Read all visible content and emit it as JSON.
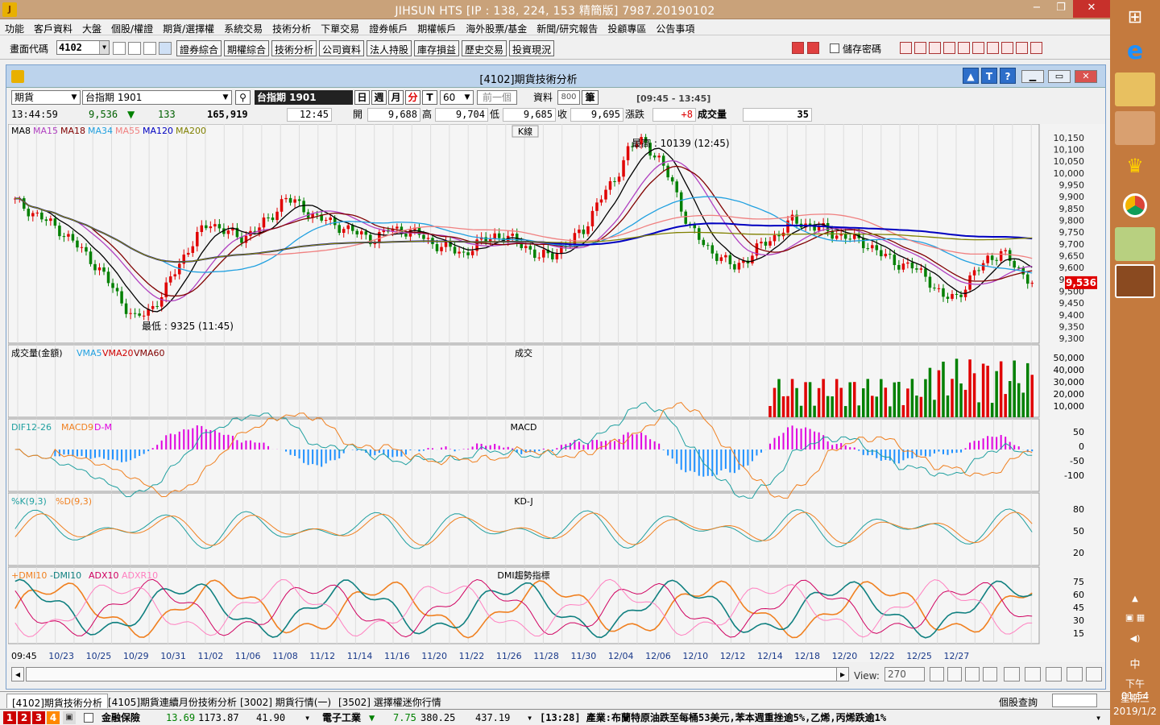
{
  "window": {
    "title": "JIHSUN HTS     [IP : 138, 224, 153 精簡版] 7987.20190102",
    "app_icon": "jihsun-logo",
    "controls": [
      "−",
      "❐",
      "✕"
    ]
  },
  "menu": [
    "功能",
    "客戶資料",
    "大盤",
    "個股/權證",
    "期貨/選擇權",
    "系統交易",
    "技術分析",
    "下單交易",
    "證券帳戶",
    "期權帳戶",
    "海外股票/基金",
    "新聞/研究報告",
    "投顧專區",
    "公告事項"
  ],
  "toolbar": {
    "code_label": "畫面代碼",
    "code_value": "4102",
    "buttons": [
      "證券綜合",
      "期權綜合",
      "技術分析",
      "公司資料",
      "法人持股",
      "庫存損益",
      "歷史交易",
      "投資現況"
    ],
    "save_code_label": "儲存密碼"
  },
  "inner": {
    "title": "[4102]期貨技術分析",
    "help_buttons": [
      "▲",
      "T",
      "?"
    ],
    "controls": [
      "▁",
      "▭",
      "✕"
    ]
  },
  "controls": {
    "type": "期貨",
    "instrument": "台指期 1901",
    "instrument_name": "台指期 1901",
    "periods": [
      "日",
      "週",
      "月",
      "分",
      "T"
    ],
    "interval": "60",
    "prev_button": "前一個",
    "data_label": "資料",
    "data_count": "800",
    "data_unit": "筆",
    "session": "[09:45 - 13:45]"
  },
  "quote": {
    "time": "13:44:59",
    "price": "9,536",
    "arrow": "▼",
    "change": "133",
    "volume": "165,919",
    "bar_time": "12:45",
    "open_label": "開",
    "open": "9,688",
    "high_label": "高",
    "high": "9,704",
    "low_label": "低",
    "low": "9,685",
    "close_label": "收",
    "close": "9,695",
    "chg_label": "漲跌",
    "chg": "+8",
    "vol_label": "成交量",
    "vol": "35"
  },
  "panels": {
    "kline": {
      "title": "K線",
      "legend": [
        {
          "name": "MA8",
          "color": "#000000"
        },
        {
          "name": "MA15",
          "color": "#b040c0"
        },
        {
          "name": "MA18",
          "color": "#800000"
        },
        {
          "name": "MA34",
          "color": "#20a0e0"
        },
        {
          "name": "MA55",
          "color": "#f08080"
        },
        {
          "name": "MA120",
          "color": "#0000c0"
        },
        {
          "name": "MA200",
          "color": "#808000"
        }
      ],
      "high_label": "最高 : 10139 (12:45)",
      "low_label": "最低 : 9325 (11:45)",
      "current_price": "9,536"
    },
    "volume": {
      "title": "成交",
      "legend": [
        {
          "name": "成交量(金額)",
          "color": "#000000"
        },
        {
          "name": "VMA5",
          "color": "#20a0e0"
        },
        {
          "name": "VMA20",
          "color": "#d00000"
        },
        {
          "name": "VMA60",
          "color": "#800000"
        }
      ]
    },
    "macd": {
      "title": "MACD",
      "legend": [
        {
          "name": "DIF12-26",
          "color": "#20a0a0"
        },
        {
          "name": "MACD9",
          "color": "#f08020"
        },
        {
          "name": "D-M",
          "color": "#e000e0"
        }
      ]
    },
    "kd": {
      "title": "KD-J",
      "legend": [
        {
          "name": "%K(9,3)",
          "color": "#20a0a0"
        },
        {
          "name": "%D(9,3)",
          "color": "#f08020"
        }
      ]
    },
    "dmi": {
      "title": "DMI趨勢指標",
      "legend": [
        {
          "name": "+DMI10",
          "color": "#f08020"
        },
        {
          "name": "-DMI10",
          "color": "#108080"
        },
        {
          "name": "ADX10",
          "color": "#d00060"
        },
        {
          "name": "ADXR10",
          "color": "#ff80c0"
        }
      ]
    }
  },
  "chart_data": {
    "type": "candlestick",
    "x_labels": [
      "09:45",
      "10/23",
      "10/25",
      "10/29",
      "10/31",
      "11/02",
      "11/06",
      "11/08",
      "11/12",
      "11/14",
      "11/16",
      "11/20",
      "11/22",
      "11/26",
      "11/28",
      "11/30",
      "12/04",
      "12/06",
      "12/10",
      "12/12",
      "12/14",
      "12/18",
      "12/20",
      "12/22",
      "12/25",
      "12/27"
    ],
    "price_axis": [
      "10,150",
      "10,100",
      "10,050",
      "10,000",
      "9,950",
      "9,900",
      "9,850",
      "9,800",
      "9,750",
      "9,700",
      "9,650",
      "9,600",
      "9,550",
      "9,500",
      "9,450",
      "9,400",
      "9,350",
      "9,300"
    ],
    "volume_axis": [
      "50,000",
      "40,000",
      "30,000",
      "20,000",
      "10,000"
    ],
    "macd_axis": [
      "50",
      "0",
      "-50",
      "-100"
    ],
    "kd_axis": [
      "80",
      "50",
      "20"
    ],
    "dmi_axis": [
      "75",
      "60",
      "45",
      "30",
      "15"
    ],
    "close_anchors": [
      9880,
      9840,
      9800,
      9760,
      9700,
      9640,
      9560,
      9470,
      9380,
      9420,
      9500,
      9620,
      9720,
      9790,
      9760,
      9720,
      9760,
      9800,
      9900,
      9860,
      9820,
      9790,
      9770,
      9740,
      9720,
      9760,
      9760,
      9740,
      9700,
      9680,
      9660,
      9700,
      9740,
      9720,
      9700,
      9640,
      9660,
      9700,
      9760,
      9880,
      9960,
      10100,
      10139,
      10060,
      9950,
      9780,
      9700,
      9650,
      9600,
      9640,
      9700,
      9740,
      9800,
      9780,
      9760,
      9740,
      9720,
      9700,
      9650,
      9620,
      9600,
      9560,
      9470,
      9480,
      9560,
      9640,
      9660,
      9600,
      9536
    ],
    "high": "10139",
    "low": "9325",
    "last": "9536"
  },
  "bottom": {
    "view_label": "View:",
    "view_value": "270"
  },
  "tabs": [
    "[4102]期貨技術分析",
    "[4105]期貨連續月份技術分析",
    "[3002] 期貨行情(一)",
    "[3502] 選擇權迷你行情"
  ],
  "tabs_right": "個股查詢",
  "ticker": {
    "nums": [
      "1",
      "2",
      "3",
      "4"
    ],
    "sector1": "金融保險",
    "s1_change": "13.69",
    "s1_index": "1173.87",
    "s1_val": "41.90",
    "sector2": "電子工業",
    "s2_arrow": "▼",
    "s2_change": "7.75",
    "s2_index": "380.25",
    "s2_val": "437.19",
    "news": "[13:28] 產業:布蘭特原油跌至每桶53美元,苯本週重挫逾5%,乙烯,丙烯跌逾1%"
  },
  "taskbar": {
    "ime": "中",
    "time": "下午 01:54",
    "day": "星期三",
    "date": "2019/1/2"
  }
}
